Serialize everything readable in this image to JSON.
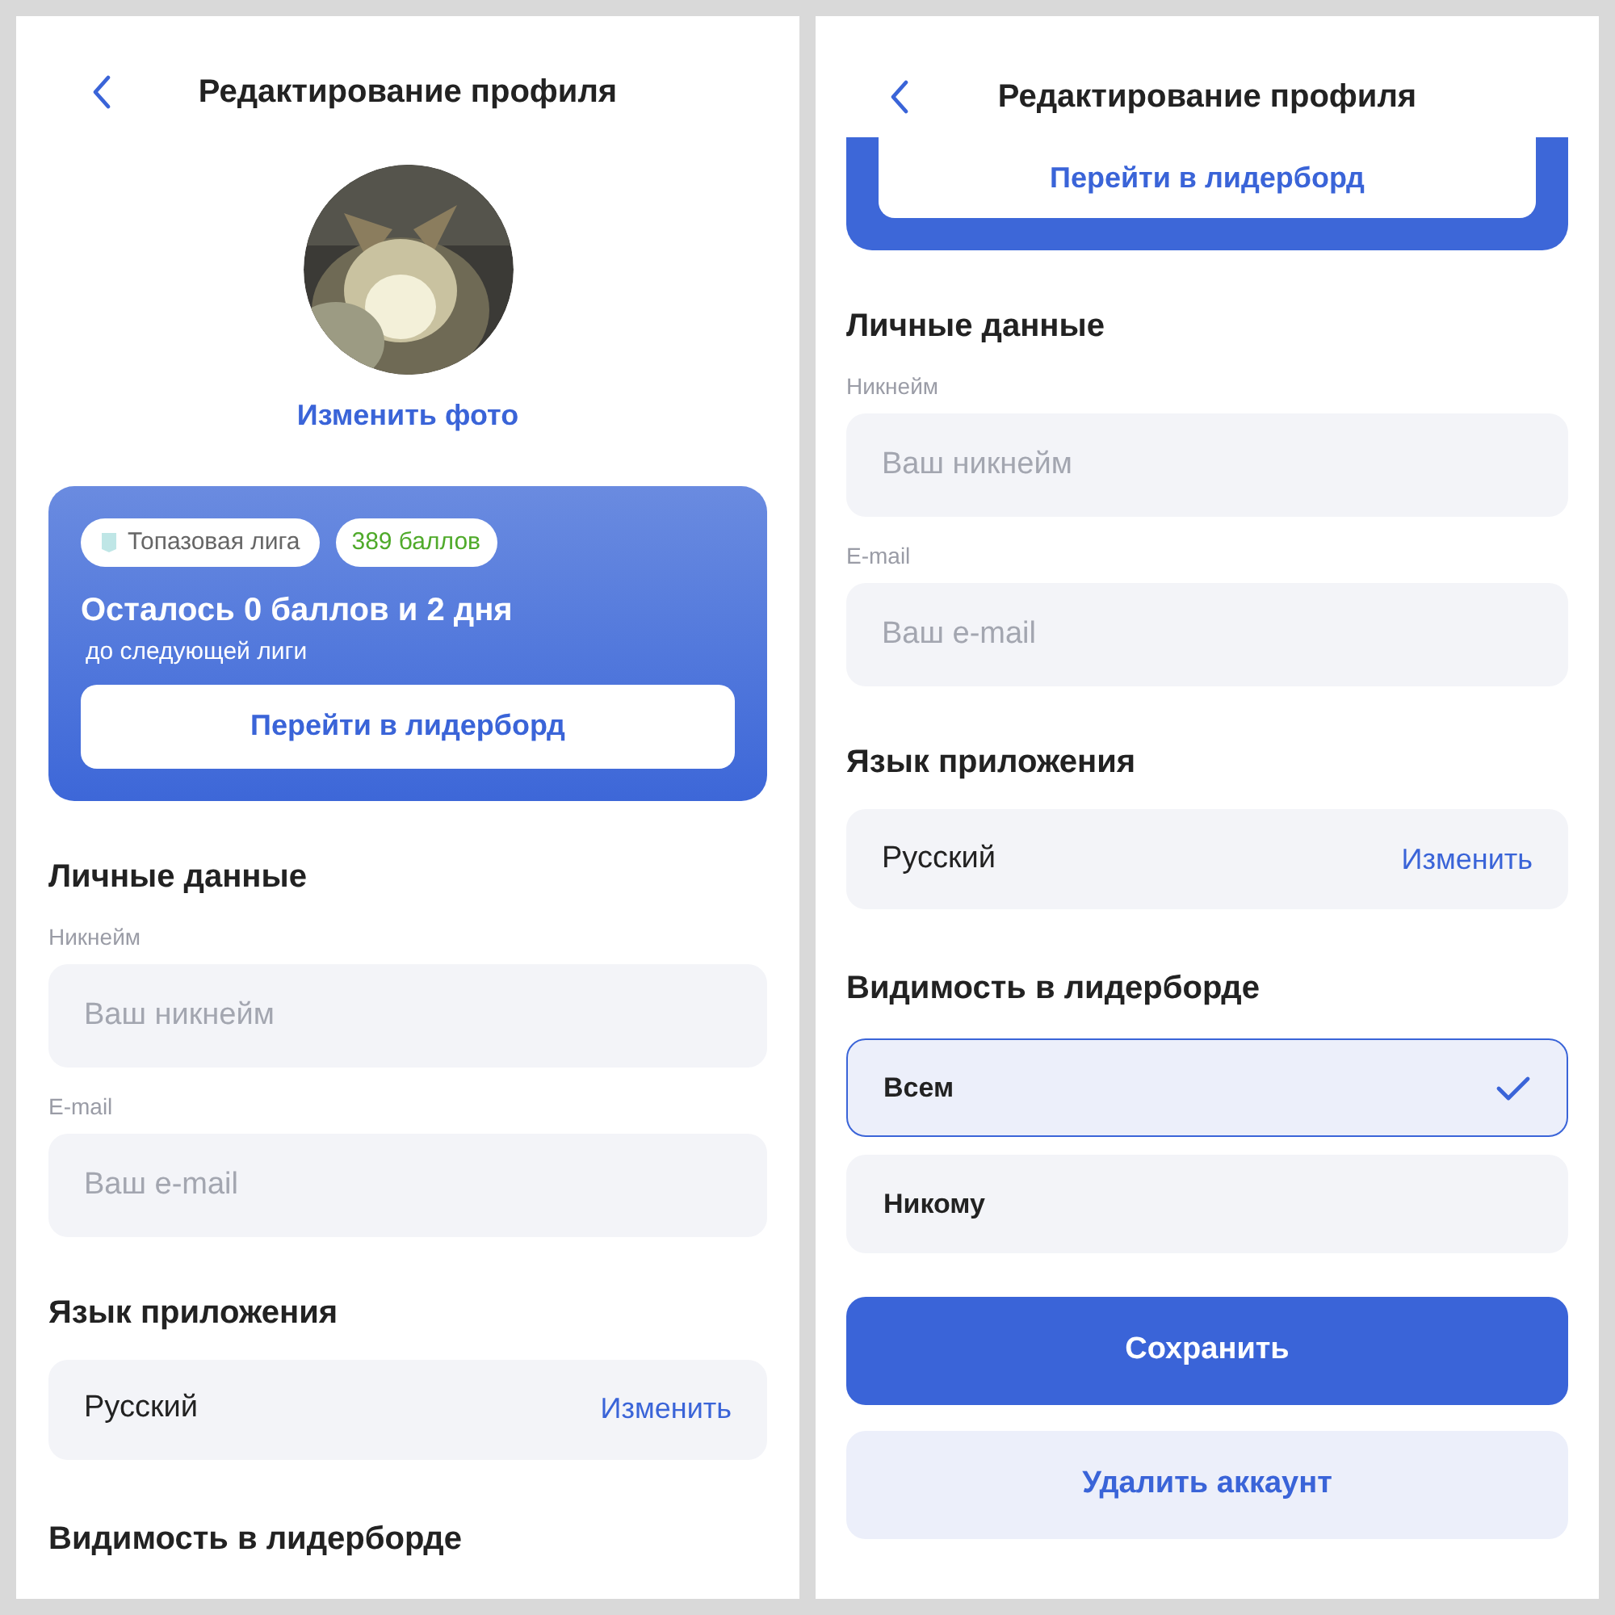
{
  "screens": [
    {
      "title": "Редактирование профиля",
      "change_photo": "Изменить фото",
      "league_card": {
        "league": "Топазовая лига",
        "points": "389 баллов",
        "remaining": "Осталось 0 баллов и 2 дня",
        "subtitle": "до следующей лиги",
        "button": "Перейти в лидерборд"
      },
      "personal": {
        "heading": "Личные данные",
        "fields": [
          {
            "label": "Никнейм",
            "placeholder": "Ваш никнейм"
          },
          {
            "label": "E-mail",
            "placeholder": "Ваш e-mail"
          }
        ]
      },
      "language": {
        "heading": "Язык приложения",
        "value": "Русский",
        "action": "Изменить"
      },
      "visibility": {
        "heading": "Видимость в лидерборде"
      }
    },
    {
      "title": "Редактирование профиля",
      "leaderboard_button": "Перейти в лидерборд",
      "personal": {
        "heading": "Личные данные",
        "fields": [
          {
            "label": "Никнейм",
            "placeholder": "Ваш никнейм"
          },
          {
            "label": "E-mail",
            "placeholder": "Ваш e-mail"
          }
        ]
      },
      "language": {
        "heading": "Язык приложения",
        "value": "Русский",
        "action": "Изменить"
      },
      "visibility": {
        "heading": "Видимость в лидерборде",
        "options": [
          {
            "label": "Всем",
            "selected": true
          },
          {
            "label": "Никому",
            "selected": false
          }
        ]
      },
      "buttons": [
        {
          "kind": "primary",
          "label": "Сохранить"
        },
        {
          "kind": "secondary",
          "label": "Удалить аккаунт"
        }
      ]
    }
  ]
}
